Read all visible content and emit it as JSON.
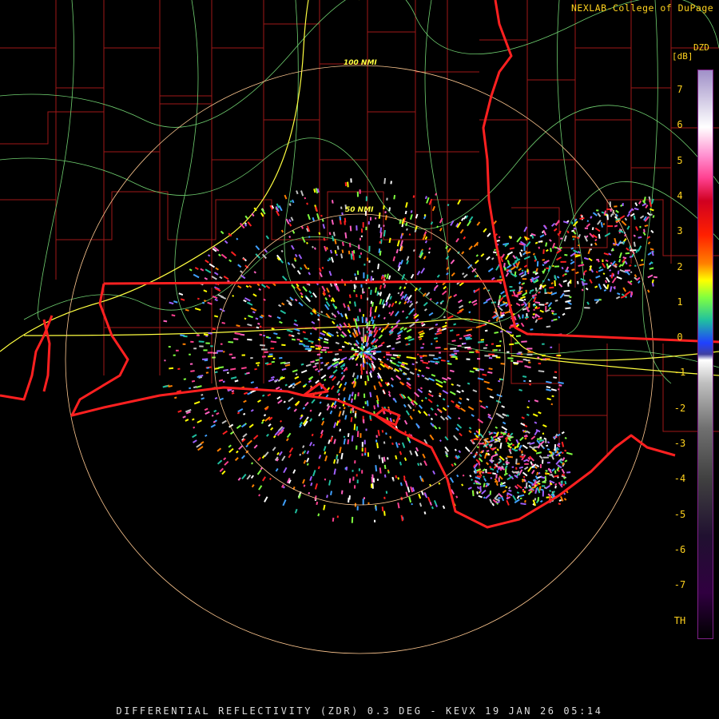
{
  "header": {
    "credit": "NEXLAB-College of DuPage",
    "product_code": "DZD",
    "unit": "[dB]"
  },
  "range_rings": {
    "inner_label": "50 NMI",
    "outer_label": "100 NMI"
  },
  "legend": {
    "ticks": [
      "7",
      "6",
      "5",
      "4",
      "3",
      "2",
      "1",
      "0",
      "-1",
      "-2",
      "-3",
      "-4",
      "-5",
      "-6",
      "-7",
      "TH"
    ]
  },
  "footer": {
    "caption": "DIFFERENTIAL REFLECTIVITY (ZDR) 0.3 DEG - KEVX 19 JAN 26 05:14"
  },
  "colors": {
    "background": "#000000",
    "state_borders": "#ff2020",
    "county_lines": "#a01818",
    "highways": "#ffff40",
    "roads": "#70d070",
    "range_rings": "#ffc890",
    "text": "#ffd21e"
  }
}
